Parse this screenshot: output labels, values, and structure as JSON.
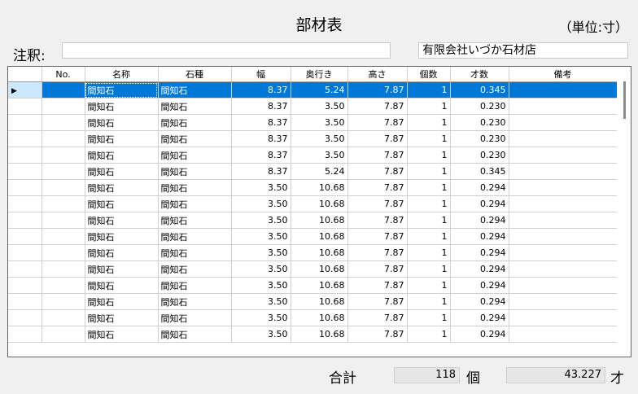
{
  "header": {
    "title": "部材表",
    "unit_note": "（単位:寸）"
  },
  "note": {
    "label": "注釈:",
    "value": "",
    "shop_name": "有限会社いづか石材店"
  },
  "grid": {
    "columns": [
      "",
      "No.",
      "名称",
      "石種",
      "幅",
      "奥行き",
      "高さ",
      "個数",
      "才数",
      "備考"
    ],
    "selected_row": 0,
    "rows": [
      {
        "no": "",
        "name": "間知石",
        "stone": "間知石",
        "width": "8.37",
        "depth": "5.24",
        "height": "7.87",
        "count": "1",
        "sai": "0.345",
        "remarks": ""
      },
      {
        "no": "",
        "name": "間知石",
        "stone": "間知石",
        "width": "8.37",
        "depth": "3.50",
        "height": "7.87",
        "count": "1",
        "sai": "0.230",
        "remarks": ""
      },
      {
        "no": "",
        "name": "間知石",
        "stone": "間知石",
        "width": "8.37",
        "depth": "3.50",
        "height": "7.87",
        "count": "1",
        "sai": "0.230",
        "remarks": ""
      },
      {
        "no": "",
        "name": "間知石",
        "stone": "間知石",
        "width": "8.37",
        "depth": "3.50",
        "height": "7.87",
        "count": "1",
        "sai": "0.230",
        "remarks": ""
      },
      {
        "no": "",
        "name": "間知石",
        "stone": "間知石",
        "width": "8.37",
        "depth": "3.50",
        "height": "7.87",
        "count": "1",
        "sai": "0.230",
        "remarks": ""
      },
      {
        "no": "",
        "name": "間知石",
        "stone": "間知石",
        "width": "8.37",
        "depth": "5.24",
        "height": "7.87",
        "count": "1",
        "sai": "0.345",
        "remarks": ""
      },
      {
        "no": "",
        "name": "間知石",
        "stone": "間知石",
        "width": "3.50",
        "depth": "10.68",
        "height": "7.87",
        "count": "1",
        "sai": "0.294",
        "remarks": ""
      },
      {
        "no": "",
        "name": "間知石",
        "stone": "間知石",
        "width": "3.50",
        "depth": "10.68",
        "height": "7.87",
        "count": "1",
        "sai": "0.294",
        "remarks": ""
      },
      {
        "no": "",
        "name": "間知石",
        "stone": "間知石",
        "width": "3.50",
        "depth": "10.68",
        "height": "7.87",
        "count": "1",
        "sai": "0.294",
        "remarks": ""
      },
      {
        "no": "",
        "name": "間知石",
        "stone": "間知石",
        "width": "3.50",
        "depth": "10.68",
        "height": "7.87",
        "count": "1",
        "sai": "0.294",
        "remarks": ""
      },
      {
        "no": "",
        "name": "間知石",
        "stone": "間知石",
        "width": "3.50",
        "depth": "10.68",
        "height": "7.87",
        "count": "1",
        "sai": "0.294",
        "remarks": ""
      },
      {
        "no": "",
        "name": "間知石",
        "stone": "間知石",
        "width": "3.50",
        "depth": "10.68",
        "height": "7.87",
        "count": "1",
        "sai": "0.294",
        "remarks": ""
      },
      {
        "no": "",
        "name": "間知石",
        "stone": "間知石",
        "width": "3.50",
        "depth": "10.68",
        "height": "7.87",
        "count": "1",
        "sai": "0.294",
        "remarks": ""
      },
      {
        "no": "",
        "name": "間知石",
        "stone": "間知石",
        "width": "3.50",
        "depth": "10.68",
        "height": "7.87",
        "count": "1",
        "sai": "0.294",
        "remarks": ""
      },
      {
        "no": "",
        "name": "間知石",
        "stone": "間知石",
        "width": "3.50",
        "depth": "10.68",
        "height": "7.87",
        "count": "1",
        "sai": "0.294",
        "remarks": ""
      },
      {
        "no": "",
        "name": "間知石",
        "stone": "間知石",
        "width": "3.50",
        "depth": "10.68",
        "height": "7.87",
        "count": "1",
        "sai": "0.294",
        "remarks": ""
      }
    ]
  },
  "footer": {
    "total_label": "合計",
    "total_count": "118",
    "count_unit": "個",
    "total_sai": "43.227",
    "sai_unit": "才"
  },
  "colors": {
    "selection": "#0078d7",
    "row_header_selected": "#cce8ff"
  }
}
